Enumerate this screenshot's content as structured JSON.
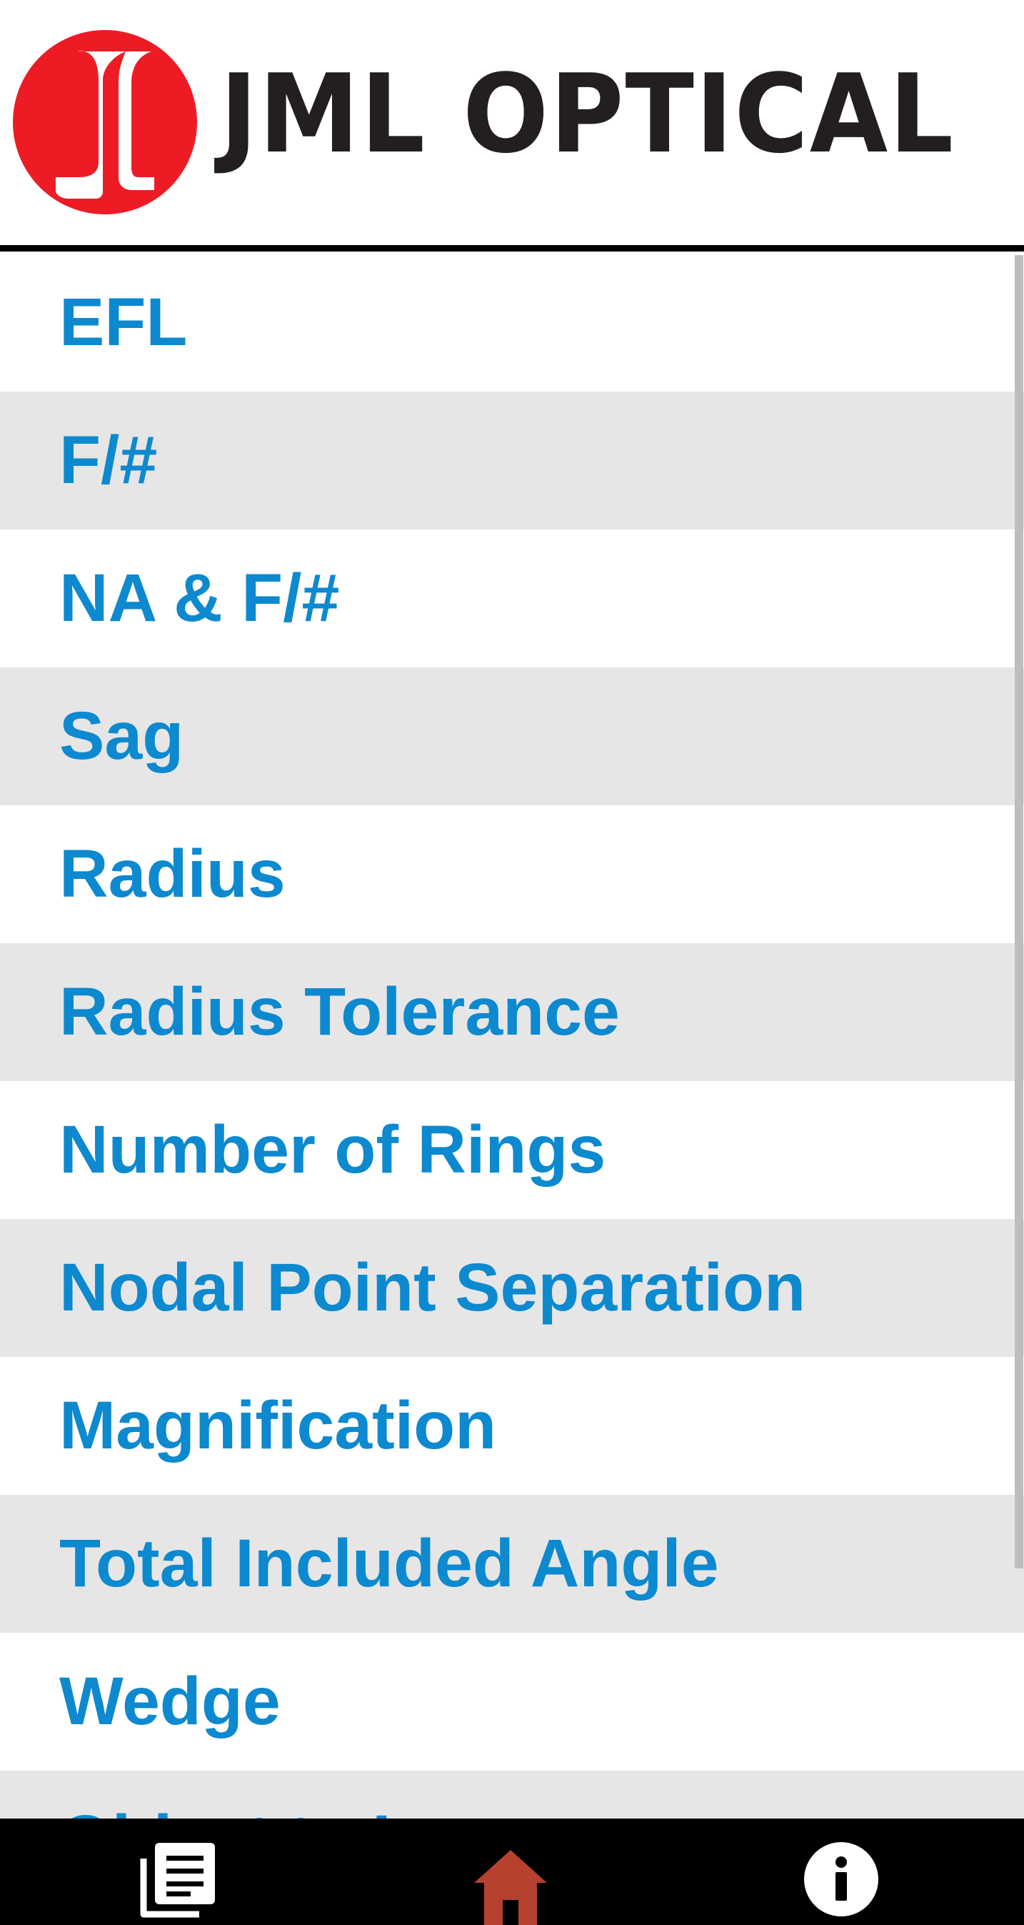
{
  "header": {
    "brand": "JML OPTICAL",
    "logo_icon": "jml-logo-icon"
  },
  "menu": {
    "items": [
      {
        "label": "EFL"
      },
      {
        "label": "F/#"
      },
      {
        "label": "NA & F/#"
      },
      {
        "label": "Sag"
      },
      {
        "label": "Radius"
      },
      {
        "label": "Radius Tolerance"
      },
      {
        "label": "Number of Rings"
      },
      {
        "label": "Nodal Point Separation"
      },
      {
        "label": "Magnification"
      },
      {
        "label": "Total Included Angle"
      },
      {
        "label": "Wedge"
      },
      {
        "label": "Object to Image"
      }
    ]
  },
  "bottom_nav": {
    "items": [
      {
        "name": "articles",
        "icon": "article-icon"
      },
      {
        "name": "home",
        "icon": "home-icon",
        "active": true
      },
      {
        "name": "info",
        "icon": "info-icon"
      }
    ]
  },
  "colors": {
    "label": "#0d89cf",
    "alt_row": "#e6e6e7",
    "logo_red": "#ed1c24",
    "brand_text": "#231f20",
    "nav_bg": "#000000",
    "home_active": "#b5412e",
    "nav_icon": "#ffffff"
  }
}
